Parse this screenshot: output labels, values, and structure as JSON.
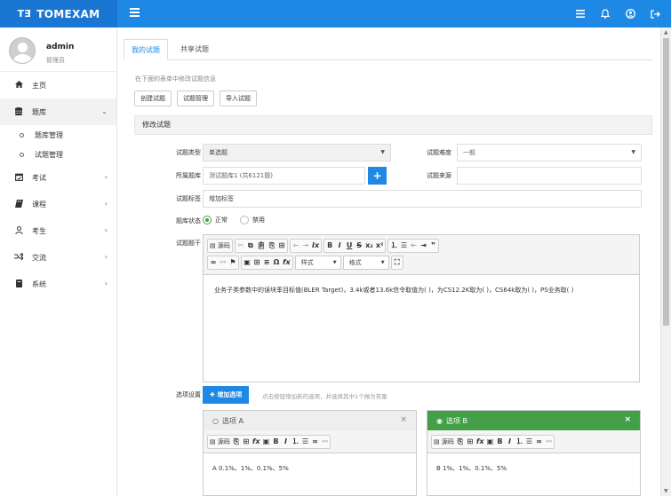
{
  "app": {
    "logo_mark": "T∃",
    "title": "TOMEXAM"
  },
  "header_icons": [
    "list-icon",
    "bell-icon",
    "user-icon",
    "logout-icon"
  ],
  "user": {
    "name": "admin",
    "role": "管理员"
  },
  "sidebar": {
    "items": [
      {
        "label": "主页",
        "icon": "home-icon"
      },
      {
        "label": "题库",
        "icon": "database-icon",
        "expanded": true,
        "children": [
          {
            "label": "题库管理"
          },
          {
            "label": "试题管理"
          }
        ]
      },
      {
        "label": "考试",
        "icon": "calendar-icon"
      },
      {
        "label": "课程",
        "icon": "book-icon"
      },
      {
        "label": "考生",
        "icon": "person-icon"
      },
      {
        "label": "交流",
        "icon": "exchange-icon"
      },
      {
        "label": "系统",
        "icon": "server-icon"
      }
    ]
  },
  "tabs": [
    {
      "label": "我的试题",
      "active": true
    },
    {
      "label": "共享试题",
      "active": false
    }
  ],
  "hint": "在下面的表单中修改试题信息",
  "actions": {
    "create": "创建试题",
    "manage": "试题管理",
    "import": "导入试题"
  },
  "panel_title": "修改试题",
  "form": {
    "type_label": "试题类型",
    "type_value": "单选题",
    "difficulty_label": "试题难度",
    "difficulty_value": "一般",
    "bank_label": "所属题库",
    "bank_value": "测试题库1 (共6121题)",
    "source_label": "试题来源",
    "source_value": "",
    "tags_label": "试题标签",
    "tags_placeholder": "增加标签",
    "status_label": "题库状态",
    "status_on": "正常",
    "status_off": "禁用",
    "stem_label": "试题题干",
    "stem_text": "业务子类参数中的误块率目标值(BLER Target)，3.4k或者13.6k信令取值为( )，为CS12.2K取为( )，CS64k取为( )，PS业务取( )",
    "options_label": "选项设置",
    "add_option": "增加选项",
    "options_hint": "点击按钮增加新的选项，并选择其中1个做为答案"
  },
  "editor": {
    "source": "源码",
    "style_combo": "样式",
    "format_combo": "格式"
  },
  "options": [
    {
      "title": "选项 A",
      "content": "A 0.1%、1%、0.1%、5%",
      "correct": false
    },
    {
      "title": "选项 B",
      "content": "B 1%、1%、0.1%、5%",
      "correct": true
    }
  ],
  "colors": {
    "primary": "#1E88E5",
    "header_dark": "#1976D2",
    "correct": "#43A047"
  }
}
